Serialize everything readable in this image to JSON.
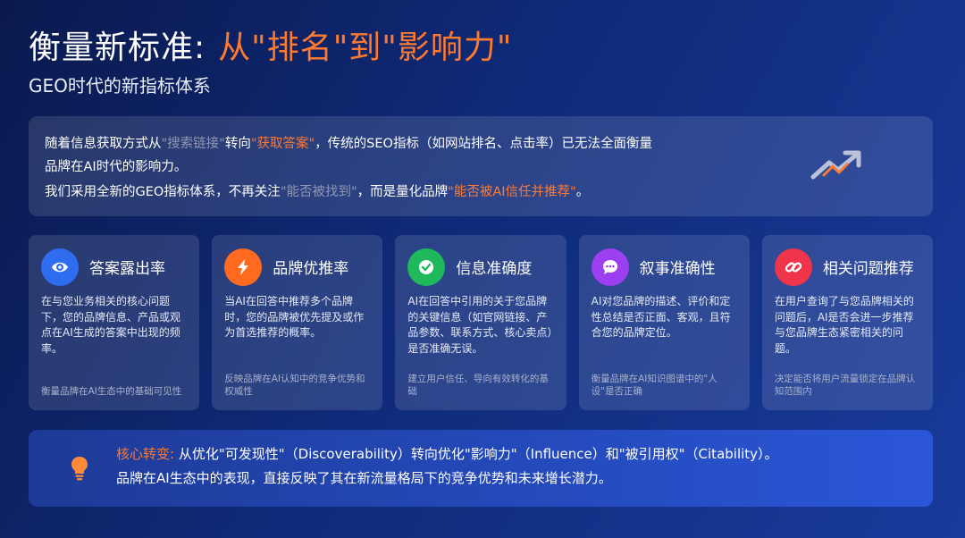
{
  "header": {
    "title": "衡量新标准:",
    "title_accent": "从\"排名\"到\"影响力\"",
    "subtitle": "GEO时代的新指标体系"
  },
  "intro": {
    "l1_a": "随着信息获取方式从",
    "l1_gray": "\"搜索链接\"",
    "l1_b": "转向",
    "l1_orange": "\"获取答案\"",
    "l1_c": "，传统的SEO指标（如网站排名、点击率）已无法全面衡量",
    "l1_d": "品牌在AI时代的影响力。",
    "l2_a": "我们采用全新的GEO指标体系，不再关注",
    "l2_gray": "\"能否被找到\"",
    "l2_b": "，而是量化品牌",
    "l2_orange": "\"能否被AI信任并推荐\"",
    "l2_c": "。",
    "icon": "trend-up-icon"
  },
  "cards": [
    {
      "icon": "eye-icon",
      "color": "#2f6df0",
      "title": "答案露出率",
      "desc": "在与您业务相关的核心问题下，您的品牌信息、产品或观点在AI生成的答案中出现的频率。",
      "foot": "衡量品牌在AI生态中的基础可见性"
    },
    {
      "icon": "lightning-icon",
      "color": "#ff6a1f",
      "title": "品牌优推率",
      "desc": "当AI在回答中推荐多个品牌时，您的品牌被优先提及或作为首选推荐的概率。",
      "foot": "反映品牌在AI认知中的竞争优势和权威性"
    },
    {
      "icon": "check-icon",
      "color": "#1fb85a",
      "title": "信息准确度",
      "desc": "AI在回答中引用的关于您品牌的关键信息（如官网链接、产品参数、联系方式、核心卖点）是否准确无误。",
      "foot": "建立用户信任、导向有效转化的基础"
    },
    {
      "icon": "chat-icon",
      "color": "#9b3ff0",
      "title": "叙事准确性",
      "desc": "AI对您品牌的描述、评价和定性总结是否正面、客观，且符合您的品牌定位。",
      "foot": "衡量品牌在AI知识图谱中的\"人设\"是否正确"
    },
    {
      "icon": "link-icon",
      "color": "#f0354a",
      "title": "相关问题推荐",
      "desc": "在用户查询了与您品牌相关的问题后，AI是否会进一步推荐与您品牌生态紧密相关的问题。",
      "foot": "决定能否将用户流量锁定在品牌认知范围内"
    }
  ],
  "bottom": {
    "icon": "lightbulb-icon",
    "label": "核心转变:",
    "l1": "从优化\"可发现性\"（Discoverability）转向优化\"影响力\"（Influence）和\"被引用权\"（Citability）。",
    "l2": "品牌在AI生态中的表现，直接反映了其在新流量格局下的竞争优势和未来增长潜力。"
  }
}
